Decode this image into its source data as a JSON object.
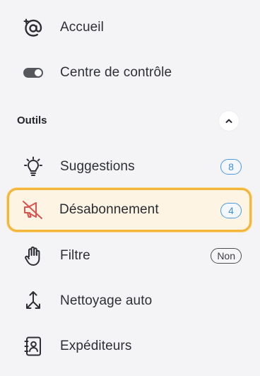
{
  "nav": {
    "accueil": "Accueil",
    "centre": "Centre de contrôle"
  },
  "section": {
    "title": "Outils"
  },
  "tools": {
    "suggestions": {
      "label": "Suggestions",
      "badge": "8"
    },
    "desabonnement": {
      "label": "Désabonnement",
      "badge": "4"
    },
    "filtre": {
      "label": "Filtre",
      "badge": "Non"
    },
    "nettoyage": {
      "label": "Nettoyage auto"
    },
    "expediteurs": {
      "label": "Expéditeurs"
    }
  },
  "colors": {
    "accent_blue": "#4a9ae0",
    "active_border": "#f3b53a",
    "active_bg": "#fdf4e4",
    "unsubscribe_icon": "#d9534f"
  }
}
